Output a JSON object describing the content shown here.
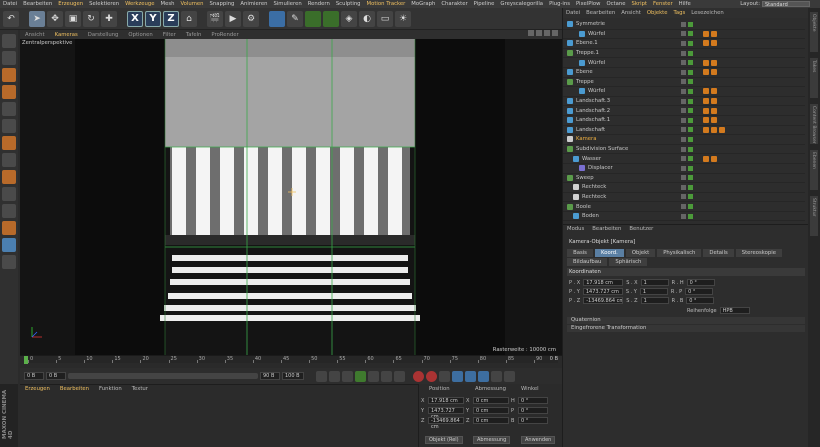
{
  "menubar": {
    "items": [
      "Datei",
      "Bearbeiten",
      "Erzeugen",
      "Selektieren",
      "Werkzeuge",
      "Mesh",
      "Volumen",
      "Snapping",
      "Animieren",
      "Simulieren",
      "Rendern",
      "Sculpting",
      "Motion Tracker",
      "MoGraph",
      "Charakter",
      "Pipeline",
      "Greyscalegorilla",
      "Plug-ins",
      "PixelPlow",
      "Octane",
      "Skript",
      "Fenster",
      "Hilfe"
    ],
    "layout_label": "Layout:",
    "layout_value": "Standard"
  },
  "viewport": {
    "menu": [
      "Ansicht",
      "Kameras",
      "Darstellung",
      "Optionen",
      "Filter",
      "Tafeln",
      "ProRender"
    ],
    "camera_label": "Zentralperspektive",
    "grid_spacing": "Rasterweite : 10000 cm"
  },
  "timeline": {
    "ticks": [
      "0",
      "5",
      "10",
      "15",
      "20",
      "25",
      "30",
      "35",
      "40",
      "45",
      "50",
      "55",
      "60",
      "65",
      "70",
      "75",
      "80",
      "85",
      "90"
    ],
    "current_frame": "0 B"
  },
  "playback": {
    "start": "0 B",
    "current": "0 B",
    "end": "90 B",
    "end2": "100 B"
  },
  "material_manager": {
    "menu": [
      "Erzeugen",
      "Bearbeiten",
      "Funktion",
      "Textur"
    ],
    "brand": "MAXON CINEMA 4D"
  },
  "coordinates": {
    "headers": [
      "Position",
      "Abmessung",
      "Winkel"
    ],
    "rows": [
      {
        "axis": "X",
        "pos": "17.918 cm",
        "size_label": "X",
        "size": "0 cm",
        "angle_label": "H",
        "angle": "0 °"
      },
      {
        "axis": "Y",
        "pos": "1473.727 cm",
        "size_label": "Y",
        "size": "0 cm",
        "angle_label": "P",
        "angle": "0 °"
      },
      {
        "axis": "Z",
        "pos": "-13469.864 cm",
        "size_label": "Z",
        "size": "0 cm",
        "angle_label": "B",
        "angle": "0 °"
      }
    ],
    "mode_select": "Objekt (Rel)",
    "size_select": "Abmessung",
    "apply_button": "Anwenden"
  },
  "object_manager": {
    "menu": [
      "Datei",
      "Bearbeiten",
      "Ansicht",
      "Objekte",
      "Tags",
      "Lesezeichen"
    ],
    "objects": [
      {
        "name": "Symmetrie",
        "indent": 0,
        "icon": "#4b9bd1",
        "tags": 0
      },
      {
        "name": "Würfel",
        "indent": 2,
        "icon": "#4b9bd1",
        "tags": 2
      },
      {
        "name": "Ebene.1",
        "indent": 0,
        "icon": "#4b9bd1",
        "tags": 2
      },
      {
        "name": "Treppe.1",
        "indent": 0,
        "icon": "#5a9b4a",
        "tags": 0
      },
      {
        "name": "Würfel",
        "indent": 2,
        "icon": "#4b9bd1",
        "tags": 2
      },
      {
        "name": "Ebene",
        "indent": 0,
        "icon": "#4b9bd1",
        "tags": 2
      },
      {
        "name": "Treppe",
        "indent": 0,
        "icon": "#5a9b4a",
        "tags": 0
      },
      {
        "name": "Würfel",
        "indent": 2,
        "icon": "#4b9bd1",
        "tags": 2
      },
      {
        "name": "Landschaft.3",
        "indent": 0,
        "icon": "#4b9bd1",
        "tags": 2
      },
      {
        "name": "Landschaft.2",
        "indent": 0,
        "icon": "#4b9bd1",
        "tags": 2
      },
      {
        "name": "Landschaft.1",
        "indent": 0,
        "icon": "#4b9bd1",
        "tags": 2
      },
      {
        "name": "Landschaft",
        "indent": 0,
        "icon": "#4b9bd1",
        "tags": 3
      },
      {
        "name": "Kamera",
        "indent": 0,
        "icon": "#cccccc",
        "tags": 0,
        "highlight": true
      },
      {
        "name": "Subdivision Surface",
        "indent": 0,
        "icon": "#5a9b4a",
        "tags": 0
      },
      {
        "name": "Wasser",
        "indent": 1,
        "icon": "#4b9bd1",
        "tags": 2
      },
      {
        "name": "Displacer",
        "indent": 2,
        "icon": "#7a6fd1",
        "tags": 0
      },
      {
        "name": "Sweep",
        "indent": 0,
        "icon": "#5a9b4a",
        "tags": 0
      },
      {
        "name": "Rechteck",
        "indent": 1,
        "icon": "#d1d1d1",
        "tags": 0
      },
      {
        "name": "Rechteck",
        "indent": 1,
        "icon": "#d1d1d1",
        "tags": 0
      },
      {
        "name": "Boole",
        "indent": 0,
        "icon": "#5a9b4a",
        "tags": 0
      },
      {
        "name": "Boden",
        "indent": 1,
        "icon": "#4b9bd1",
        "tags": 0
      }
    ]
  },
  "attribute_manager": {
    "menu": [
      "Modus",
      "Bearbeiten",
      "Benutzer"
    ],
    "title": "Kamera-Objekt [Kamera]",
    "tabs_row1": [
      "Basis",
      "Koord.",
      "Objekt",
      "Physikalisch",
      "Details",
      "Stereoskopie"
    ],
    "tabs_row2": [
      "Bildaufbau",
      "Sphärisch"
    ],
    "active_tab": "Koord.",
    "section": "Koordinaten",
    "rows": [
      {
        "l1": "P . X",
        "v1": "17.918 cm",
        "l2": "S . X",
        "v2": "1",
        "l3": "R . H",
        "v3": "0 °"
      },
      {
        "l1": "P . Y",
        "v1": "1473.727 cm",
        "l2": "S . Y",
        "v2": "1",
        "l3": "R . P",
        "v3": "0 °"
      },
      {
        "l1": "P . Z",
        "v1": "-13469.864 cm",
        "l2": "S . Z",
        "v2": "1",
        "l3": "R . B",
        "v3": "0 °"
      }
    ],
    "order_label": "Reihenfolge",
    "order_value": "HPB",
    "collapsed": [
      "Quaternion",
      "Eingefrorene Transformation"
    ]
  },
  "right_strip": [
    "Objekte",
    "Takes",
    "Content Browser",
    "Ebenen",
    "Struktur"
  ],
  "colors": {
    "accent": "#f0c060",
    "selection_tab": "#5a7fa3",
    "tag_orange": "#d37a1e",
    "check_green": "#4c9a3a"
  }
}
